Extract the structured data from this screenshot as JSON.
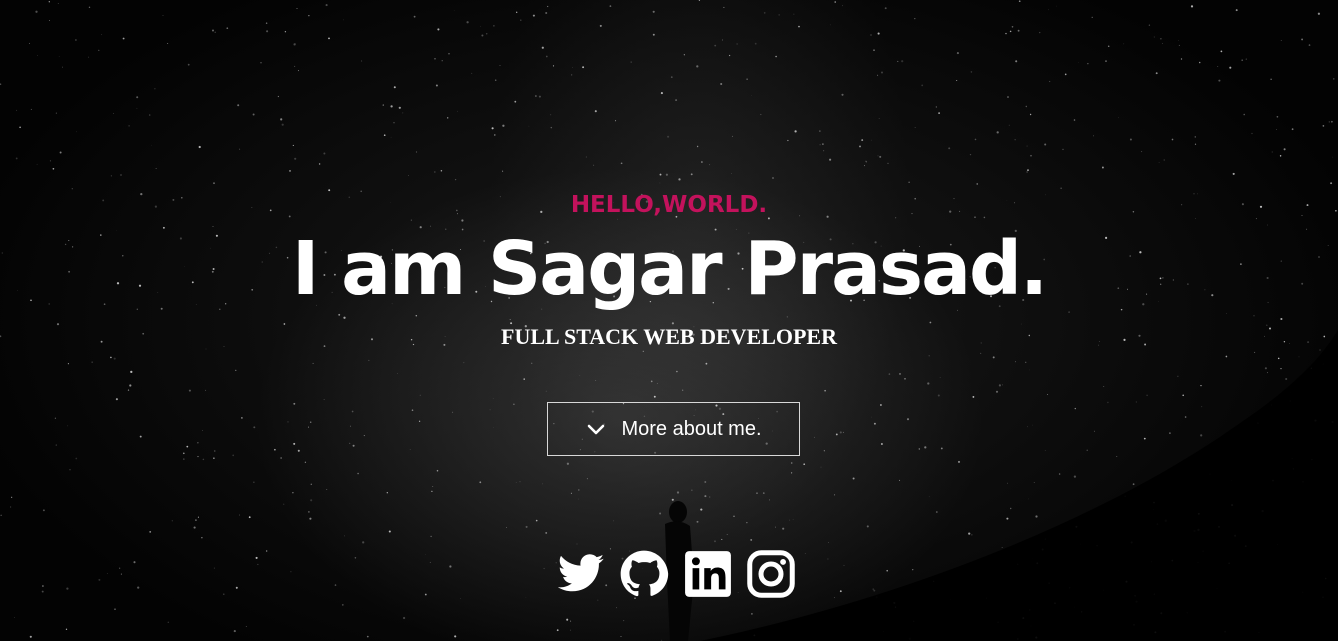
{
  "hero": {
    "kicker": "HELLO,WORLD.",
    "title": "I am Sagar Prasad.",
    "subtitle": "FULL STACK WEB DEVELOPER",
    "more_button": {
      "label": "More about me.",
      "icon": "chevron-down-icon"
    }
  },
  "socials": [
    {
      "icon": "twitter-icon"
    },
    {
      "icon": "github-icon"
    },
    {
      "icon": "linkedin-icon"
    },
    {
      "icon": "instagram-icon"
    }
  ],
  "colors": {
    "accent": "#c3125c",
    "text": "#ffffff",
    "background": "#050505"
  }
}
